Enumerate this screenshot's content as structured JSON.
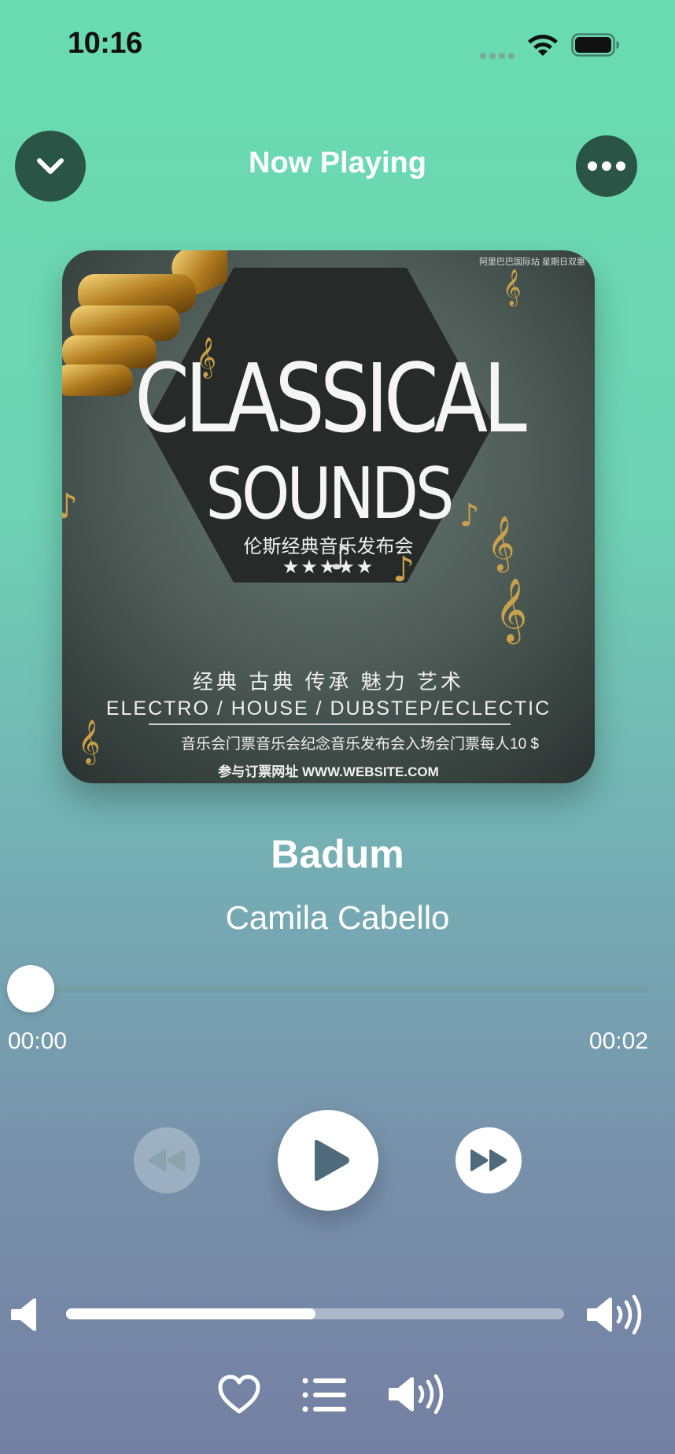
{
  "status_bar": {
    "time": "10:16"
  },
  "header": {
    "title": "Now Playing"
  },
  "album_art": {
    "title_line1": "CLASSICAL",
    "title_line2": "SOUNDS",
    "subtitle_cn": "伦斯经典音乐发布会",
    "stars": "★★★★★",
    "genres_cn": "经典  古典  传承  魅力  艺术",
    "genres": "ELECTRO / HOUSE / DUBSTEP/ECLECTIC",
    "price_line": "音乐会门票音乐会纪念音乐发布会入场会门票每人10 $",
    "website": "参与订票网址 WWW.WEBSITE.COM",
    "top_note": "阿里巴巴国际站  星期日双惠"
  },
  "track": {
    "title": "Badum",
    "artist": "Camila Cabello"
  },
  "progress": {
    "elapsed": "00:00",
    "total": "00:02",
    "fraction": 0.0
  },
  "volume": {
    "level": 0.5
  },
  "icons": {
    "collapse": "chevron-down-icon",
    "more": "ellipsis-icon",
    "rewind": "rewind-icon",
    "play": "play-icon",
    "forward": "fast-forward-icon",
    "volume_low": "speaker-icon",
    "volume_high": "speaker-wave-icon",
    "favorite": "heart-icon",
    "queue": "list-icon",
    "airplay": "speaker-wave-icon"
  },
  "colors": {
    "header_button_bg": "#2a5446",
    "bg_top": "#69dcb1",
    "bg_bottom": "#747fa3",
    "icon_dark": "#4b6a7a"
  }
}
